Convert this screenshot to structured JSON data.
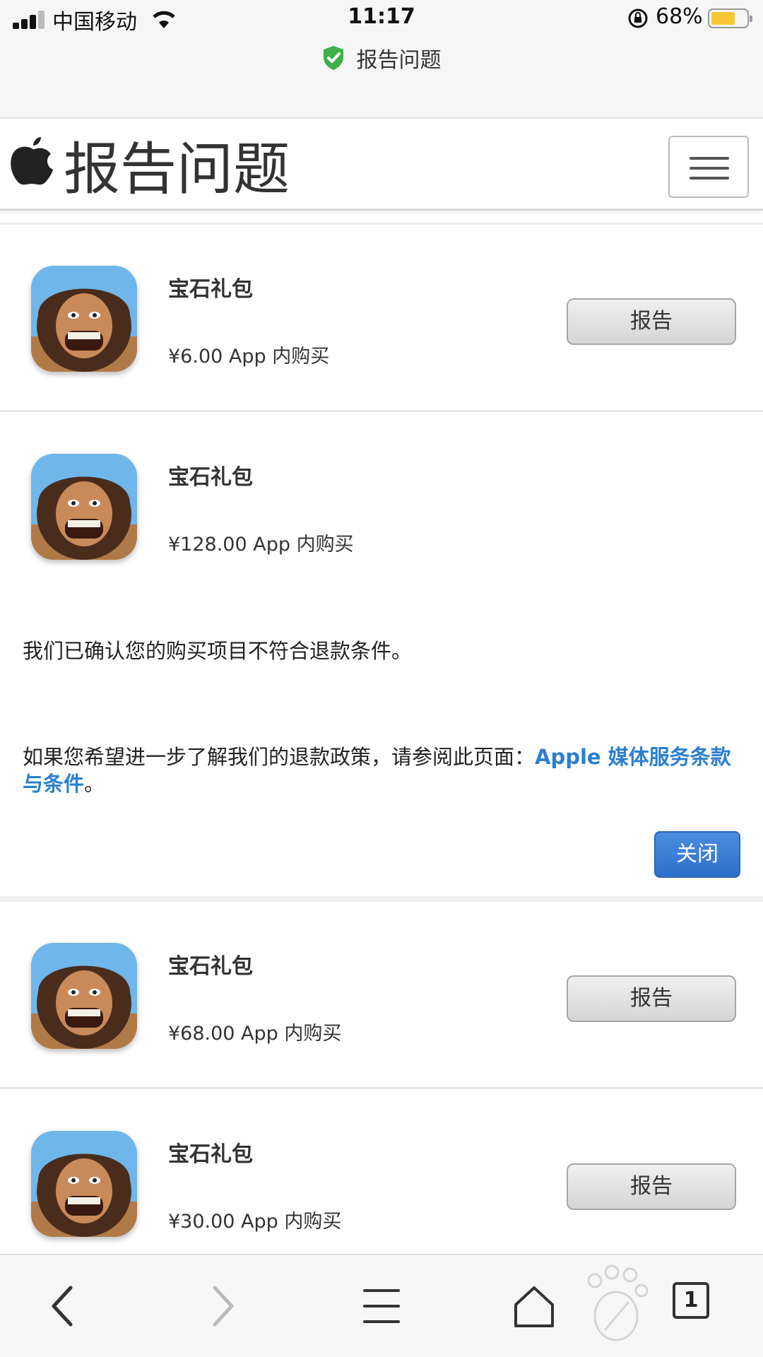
{
  "status_bar": {
    "carrier": "中国移动",
    "time": "11:17",
    "battery_percent": "68%",
    "battery_level": 0.68,
    "signal_bars": 3
  },
  "browser": {
    "url_title": "报告问题",
    "secure_icon": "green-shield-check-icon"
  },
  "header": {
    "logo": "apple-logo",
    "title": "报告问题",
    "menu_icon": "hamburger-menu-icon"
  },
  "items": [
    {
      "name": "宝石礼包",
      "price": "¥6.00 App 内购买",
      "button": "报告"
    },
    {
      "name": "宝石礼包",
      "price": "¥128.00 App 内购买",
      "expanded": true
    },
    {
      "name": "宝石礼包",
      "price": "¥68.00 App 内购买",
      "button": "报告"
    },
    {
      "name": "宝石礼包",
      "price": "¥30.00 App 内购买",
      "button": "报告"
    }
  ],
  "refund_notice": {
    "line1": "我们已确认您的购买项目不符合退款条件。",
    "line2_prefix": "如果您希望进一步了解我们的退款政策，请参阅此页面：",
    "link_text": "Apple 媒体服务条款与条件",
    "line2_suffix": "。",
    "close_button": "关闭"
  },
  "toolbar": {
    "back_icon": "chevron-left-icon",
    "forward_icon": "chevron-right-icon",
    "menu_icon": "list-menu-icon",
    "home_icon": "home-icon",
    "tab_count": "1"
  },
  "colors": {
    "link": "#2b7fd0",
    "close_button": "#3a7dd8",
    "battery": "#f7c633",
    "shield": "#3db04b"
  }
}
